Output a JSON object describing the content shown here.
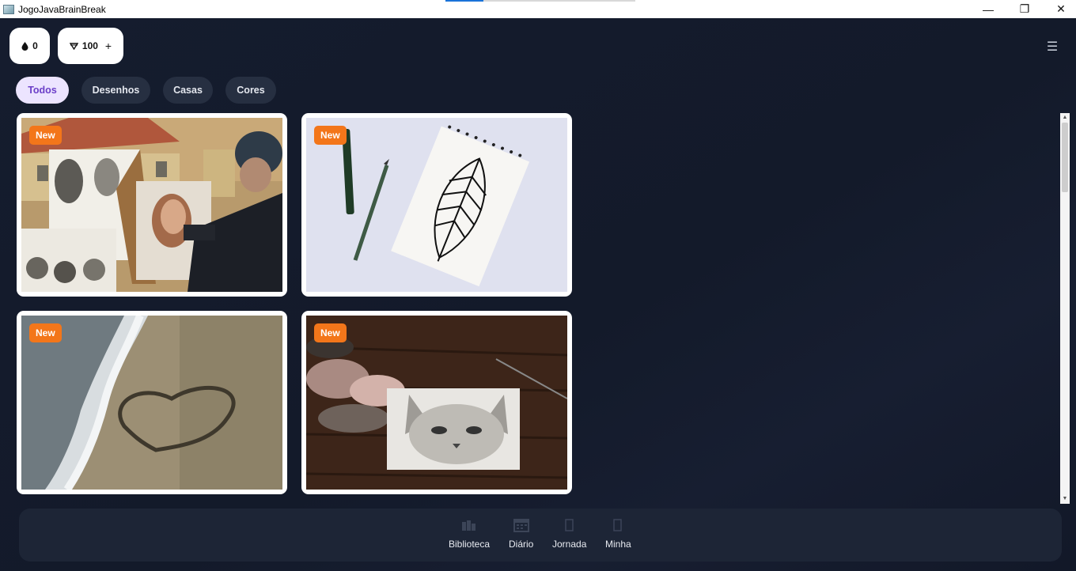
{
  "window": {
    "title": "JogoJavaBrainBreak",
    "minimize": "—",
    "maximize": "❐",
    "close": "✕"
  },
  "header": {
    "drops": {
      "icon": "drop-icon",
      "glyph": "💧",
      "value": "0"
    },
    "gems": {
      "icon": "gem-icon",
      "glyph": "▽",
      "value": "100",
      "add": "+"
    },
    "menu_glyph": "☰"
  },
  "tabs": [
    {
      "label": "Todos",
      "active": true
    },
    {
      "label": "Desenhos",
      "active": false
    },
    {
      "label": "Casas",
      "active": false
    },
    {
      "label": "Cores",
      "active": false
    }
  ],
  "cards": [
    {
      "badge": "New",
      "image": "street-artist-portraits"
    },
    {
      "badge": "New",
      "image": "feather-sketch-notebook"
    },
    {
      "badge": "New",
      "image": "heart-drawn-in-sand"
    },
    {
      "badge": "New",
      "image": "cat-pencil-sketch"
    }
  ],
  "bottom_nav": [
    {
      "label": "Biblioteca",
      "icon": "library-icon"
    },
    {
      "label": "Diário",
      "icon": "calendar-icon"
    },
    {
      "label": "Jornada",
      "icon": "journey-icon"
    },
    {
      "label": "Minha",
      "icon": "profile-icon"
    }
  ],
  "colors": {
    "background": "#141b2c",
    "badge": "#f3761a",
    "tab_active_bg": "#ece4ff",
    "tab_active_text": "#6b3fc8",
    "tab_bg": "#262f41",
    "nav_bg": "#1d2536"
  }
}
